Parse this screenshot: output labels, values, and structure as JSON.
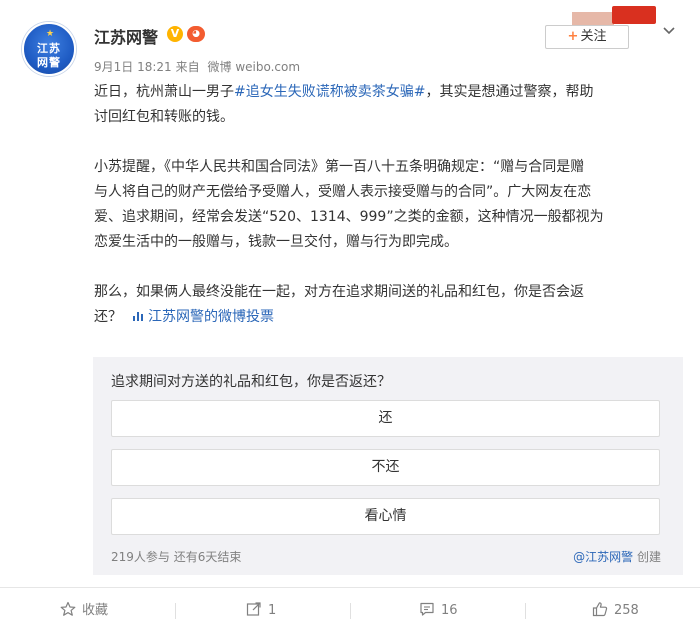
{
  "post": {
    "author": {
      "name": "江苏网警",
      "avatar_text_1": "江苏",
      "avatar_text_2": "网警",
      "verified_badge": "V"
    },
    "meta": {
      "date": "9月1日 18:21",
      "source_prefix": "来自",
      "source": "微博 weibo.com"
    },
    "follow_button": {
      "plus": "+",
      "label": "关注"
    },
    "body": {
      "p1_before": "近日，杭州萧山一男子",
      "p1_hashtag": "#追女生失败谎称被卖茶女骗#",
      "p1_line1_after": "，其实是想通过警察，帮助",
      "p1_line2": "讨回红包和转账的钱。",
      "p2_line1": "小苏提醒，《中华人民共和国合同法》第一百八十五条明确规定：“赠与合同是赠",
      "p2_line2": "与人将自己的财产无偿给予受赠人，受赠人表示接受赠与的合同”。广大网友在恋",
      "p2_line3": "爱、追求期间，经常会发送“520、1314、999”之类的金额，这种情况一般都视为",
      "p2_line4": "恋爱生活中的一般赠与，钱款一旦交付，赠与行为即完成。",
      "p3_line1": "那么，如果俩人最终没能在一起，对方在追求期间送的礼品和红包，你是否会返",
      "p3_line2": "还？",
      "vote_link": "江苏网警的微博投票"
    }
  },
  "poll": {
    "question": "追求期间对方送的礼品和红包，你是否返还？",
    "options": [
      "还",
      "不还",
      "看心情"
    ],
    "stats": "219人参与 还有6天结束",
    "creator_at": "@江苏网警",
    "creator_suffix": "创建"
  },
  "actions": {
    "favorite": "收藏",
    "repost": "1",
    "comment": "16",
    "like": "258"
  },
  "colors": {
    "link": "#2b67b8",
    "follow_plus": "#ff8140",
    "verified": "#ffb400"
  },
  "icons": [
    "star-icon",
    "repost-icon",
    "comment-icon",
    "like-icon",
    "chevron-down-icon",
    "vote-icon"
  ]
}
